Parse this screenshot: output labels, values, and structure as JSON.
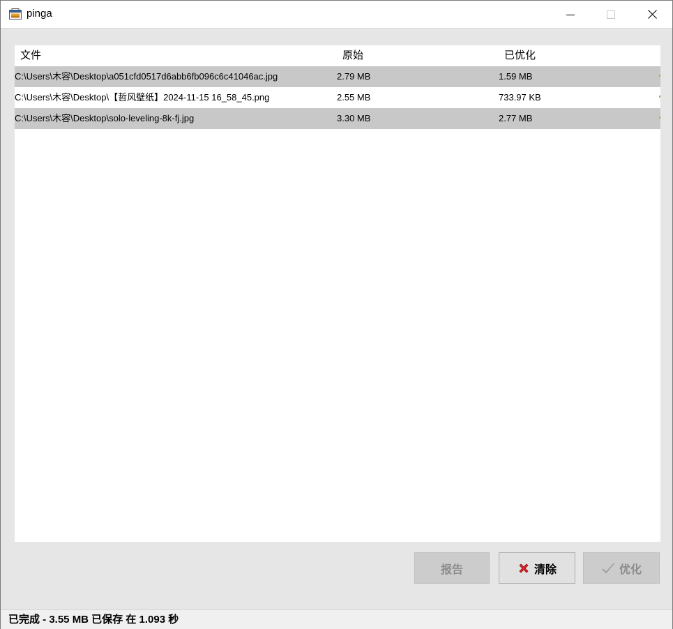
{
  "window": {
    "title": "pinga",
    "controls": {
      "minimize_icon": "minimize-icon",
      "maximize_icon": "maximize-icon",
      "close_icon": "close-icon"
    }
  },
  "list": {
    "columns": {
      "file": "文件",
      "original": "原始",
      "optimized": "已优化"
    },
    "rows": [
      {
        "file": "C:\\Users\\木容\\Desktop\\a051cfd0517d6abb6fb096c6c41046ac.jpg",
        "original": "2.79 MB",
        "optimized": "1.59 MB"
      },
      {
        "file": "C:\\Users\\木容\\Desktop\\【哲风壁纸】2024-11-15 16_58_45.png",
        "original": "2.55 MB",
        "optimized": "733.97 KB"
      },
      {
        "file": "C:\\Users\\木容\\Desktop\\solo-leveling-8k-fj.jpg",
        "original": "3.30 MB",
        "optimized": "2.77 MB"
      }
    ]
  },
  "buttons": {
    "report": "报告",
    "clear": "清除",
    "optimize": "优化"
  },
  "status": {
    "text": "已完成 - 3.55 MB 已保存 在 1.093 秒"
  },
  "colors": {
    "row_alt": "#c8c8c8",
    "clear_icon": "#d9252b",
    "disabled_text": "#8c8c8c"
  }
}
